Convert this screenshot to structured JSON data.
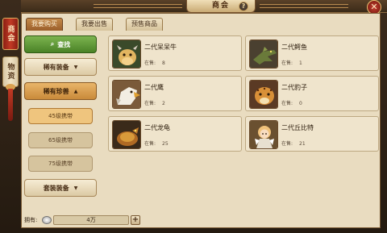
{
  "window": {
    "title": "商会"
  },
  "side_tabs": [
    {
      "label": "商会"
    },
    {
      "label": "物资"
    }
  ],
  "top_tabs": [
    {
      "label": "我要购买"
    },
    {
      "label": "我要出售"
    },
    {
      "label": "预售商品"
    }
  ],
  "menu": {
    "search_label": "查找",
    "categories": [
      {
        "label": "稀有装备"
      },
      {
        "label": "稀有珍兽"
      }
    ],
    "subcategories": [
      {
        "label": "45级携带"
      },
      {
        "label": "65级携带"
      },
      {
        "label": "75级携带"
      }
    ],
    "category_equip": {
      "label": "套装装备"
    }
  },
  "items": [
    {
      "name": "二代呆呆牛",
      "stock_label": "在售:",
      "stock": "8",
      "icon": "cow-pet-icon"
    },
    {
      "name": "二代鳄鱼",
      "stock_label": "在售:",
      "stock": "1",
      "icon": "crocodile-pet-icon"
    },
    {
      "name": "二代鹰",
      "stock_label": "在售:",
      "stock": "2",
      "icon": "eagle-pet-icon"
    },
    {
      "name": "二代豹子",
      "stock_label": "在售:",
      "stock": "0",
      "icon": "leopard-pet-icon"
    },
    {
      "name": "二代龙龟",
      "stock_label": "在售:",
      "stock": "25",
      "icon": "dragon-turtle-pet-icon"
    },
    {
      "name": "二代丘比特",
      "stock_label": "在售:",
      "stock": "21",
      "icon": "cupid-pet-icon"
    }
  ],
  "footer": {
    "owned_label": "拥有:",
    "amount": "4万",
    "add_label": "+"
  },
  "colors": {
    "accent_red": "#c23a24",
    "panel_bg": "#e9dcc0",
    "search_green": "#4a8226"
  }
}
